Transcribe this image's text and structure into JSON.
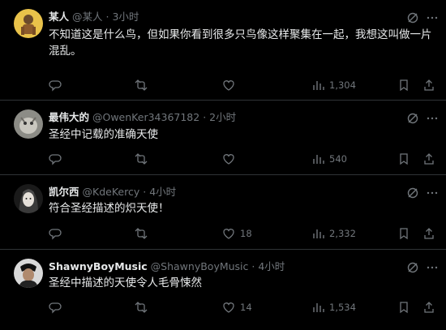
{
  "tweets": [
    {
      "display_name": "某人",
      "handle": "@某人",
      "time": "3小时",
      "text": "不知道这是什么鸟，但如果你看到很多只鸟像这样聚集在一起，我想这叫做一片混乱。",
      "replies": "",
      "retweets": "",
      "likes": "",
      "views": "1,304"
    },
    {
      "display_name": "最伟大的",
      "handle": "@OwenKer34367182",
      "time": "2小时",
      "text": "圣经中记载的准确天使",
      "replies": "",
      "retweets": "",
      "likes": "",
      "views": "540"
    },
    {
      "display_name": "凯尔西",
      "handle": "@KdeKercy",
      "time": "4小时",
      "text": "符合圣经描述的炽天使！",
      "replies": "",
      "retweets": "",
      "likes": "18",
      "views": "2,332"
    },
    {
      "display_name": "ShawnyBoyMusic",
      "handle": "@ShawnyBoyMusic",
      "time": "4小时",
      "text": "圣经中描述的天使令人毛骨悚然",
      "replies": "",
      "retweets": "",
      "likes": "14",
      "views": "1,534"
    }
  ],
  "separator": "·",
  "colors": {
    "background": "#000000",
    "text": "#e7e9ea",
    "muted": "#71767b",
    "divider": "#2f3336"
  },
  "icons": [
    "reply-icon",
    "retweet-icon",
    "like-icon",
    "views-icon",
    "bookmark-icon",
    "share-icon",
    "grok-icon",
    "more-icon"
  ]
}
